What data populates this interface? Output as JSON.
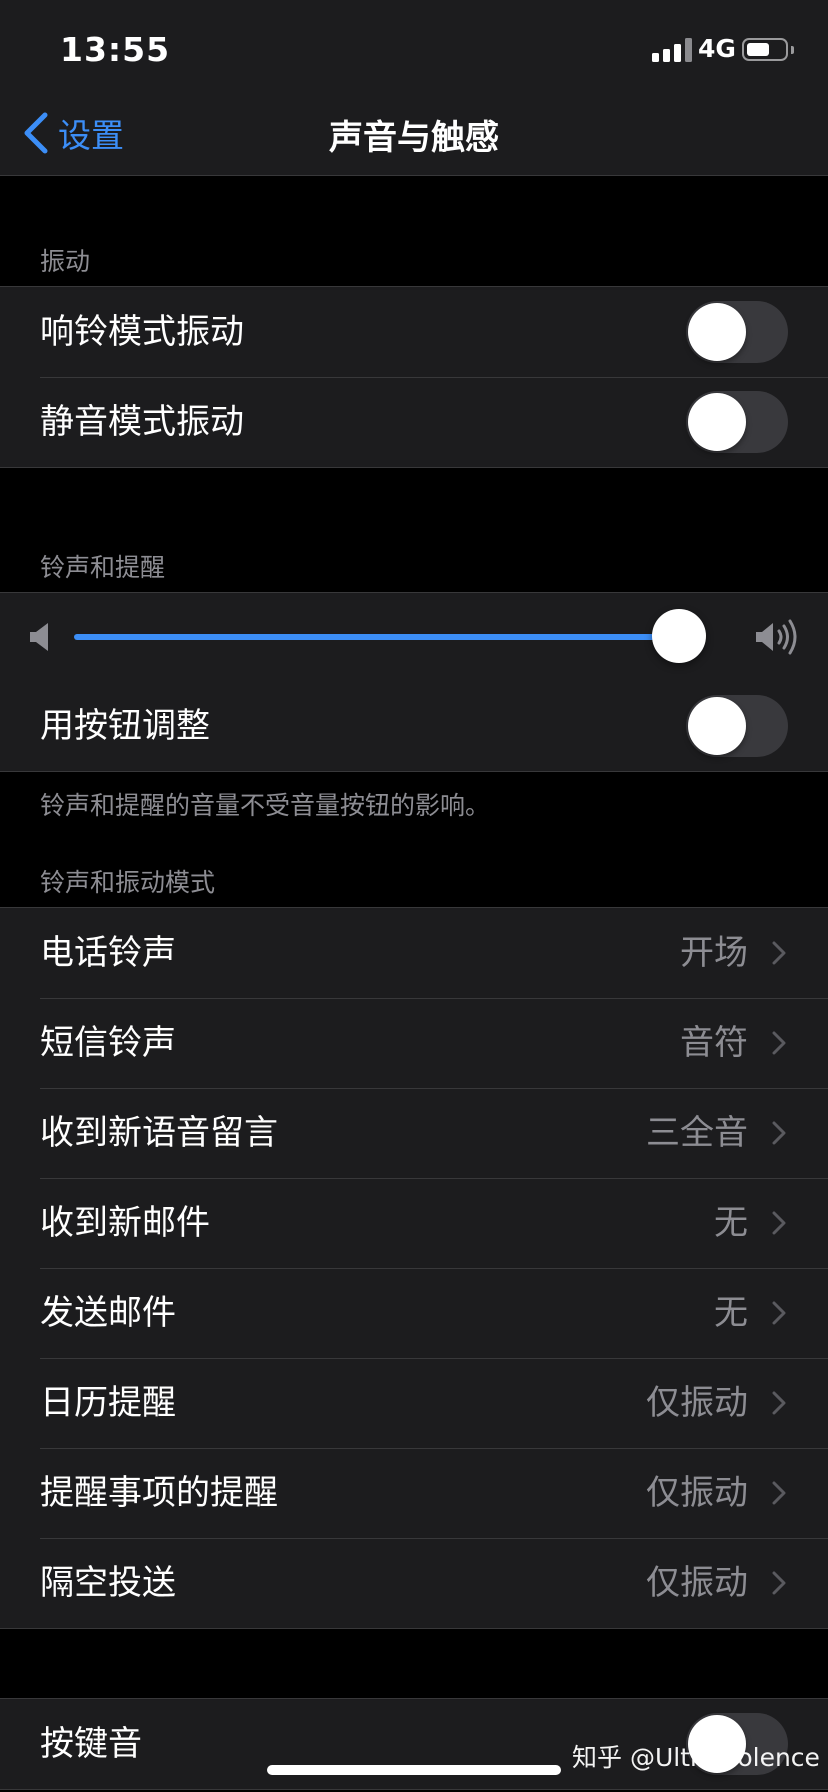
{
  "status_bar": {
    "time": "13:55",
    "network": "4G",
    "signal_bars": 4,
    "battery_level": 0.6
  },
  "nav": {
    "back_label": "设置",
    "title": "声音与触感"
  },
  "vibration": {
    "header": "振动",
    "rows": [
      {
        "label": "响铃模式振动",
        "on": false
      },
      {
        "label": "静音模式振动",
        "on": false
      }
    ]
  },
  "ringer": {
    "header": "铃声和提醒",
    "volume_level": 0.96,
    "adjust_with_buttons": {
      "label": "用按钮调整",
      "on": false
    },
    "note": "铃声和提醒的音量不受音量按钮的影响。"
  },
  "patterns": {
    "header": "铃声和振动模式",
    "rows": [
      {
        "label": "电话铃声",
        "value": "开场"
      },
      {
        "label": "短信铃声",
        "value": "音符"
      },
      {
        "label": "收到新语音留言",
        "value": "三全音"
      },
      {
        "label": "收到新邮件",
        "value": "无"
      },
      {
        "label": "发送邮件",
        "value": "无"
      },
      {
        "label": "日历提醒",
        "value": "仅振动"
      },
      {
        "label": "提醒事项的提醒",
        "value": "仅振动"
      },
      {
        "label": "隔空投送",
        "value": "仅振动"
      }
    ]
  },
  "keyboard": {
    "label": "按键音",
    "on": false
  },
  "watermark": "知乎 @Ultraviolence",
  "colors": {
    "accent": "#3c8ef7",
    "background": "#000000",
    "cell": "#1c1c1e",
    "secondary_text": "#8d8d93",
    "toggle_off": "#39393d"
  }
}
